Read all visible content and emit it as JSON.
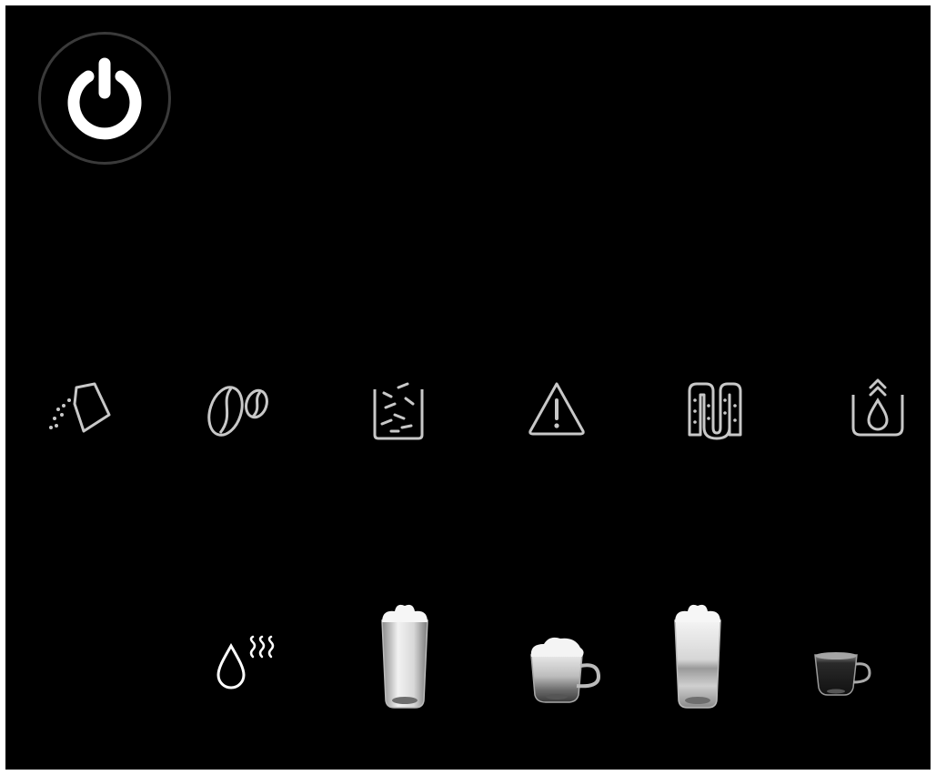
{
  "colors": {
    "background": "#000000",
    "frame": "#ffffff",
    "icon_gray": "#c8c8c8",
    "power_ring": "#3a3a3a",
    "power_glyph": "#ffffff"
  },
  "power": {
    "icon": "power-icon"
  },
  "status_indicators": [
    {
      "icon": "add-ground-coffee-icon"
    },
    {
      "icon": "coffee-beans-icon"
    },
    {
      "icon": "empty-grounds-container-icon"
    },
    {
      "icon": "warning-icon"
    },
    {
      "icon": "descale-icon"
    },
    {
      "icon": "water-tank-icon"
    }
  ],
  "drinks": [
    {
      "icon": "hot-water-icon"
    },
    {
      "icon": "latte-glass-icon"
    },
    {
      "icon": "cappuccino-cup-icon"
    },
    {
      "icon": "latte-macchiato-glass-icon"
    },
    {
      "icon": "espresso-cup-icon"
    }
  ]
}
